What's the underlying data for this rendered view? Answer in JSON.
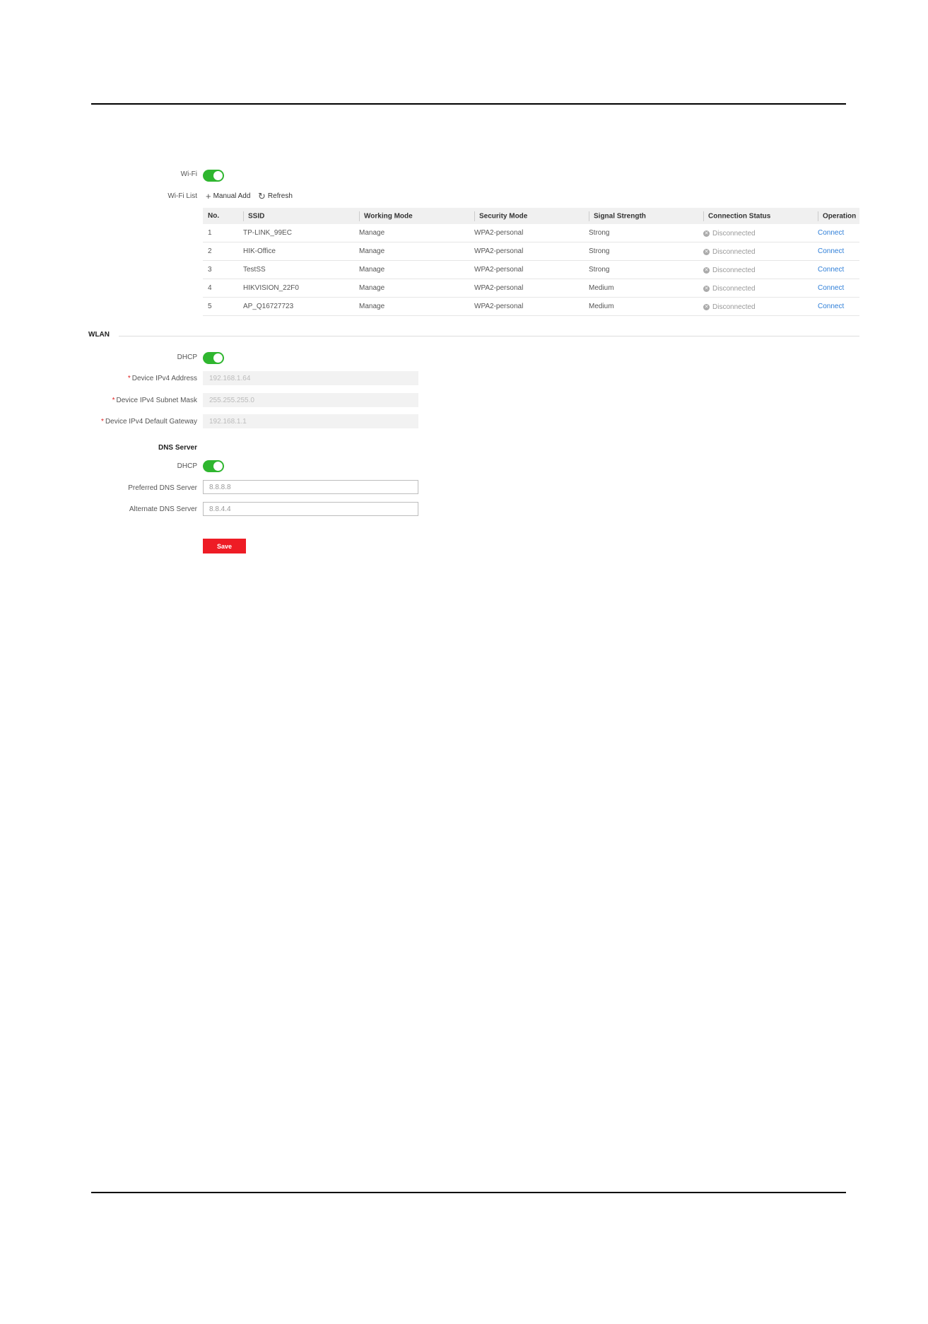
{
  "wifi": {
    "label": "Wi-Fi",
    "enabled": true
  },
  "wifi_list": {
    "label": "Wi-Fi List",
    "manual_add": "Manual Add",
    "refresh": "Refresh",
    "columns": [
      "No.",
      "SSID",
      "Working Mode",
      "Security Mode",
      "Signal Strength",
      "Connection Status",
      "Operation"
    ],
    "rows": [
      {
        "no": "1",
        "ssid": "TP-LINK_99EC",
        "mode": "Manage",
        "security": "WPA2-personal",
        "signal": "Strong",
        "status": "Disconnected",
        "op": "Connect"
      },
      {
        "no": "2",
        "ssid": "HIK-Office",
        "mode": "Manage",
        "security": "WPA2-personal",
        "signal": "Strong",
        "status": "Disconnected",
        "op": "Connect"
      },
      {
        "no": "3",
        "ssid": "TestSS",
        "mode": "Manage",
        "security": "WPA2-personal",
        "signal": "Strong",
        "status": "Disconnected",
        "op": "Connect"
      },
      {
        "no": "4",
        "ssid": "HIKVISION_22F0",
        "mode": "Manage",
        "security": "WPA2-personal",
        "signal": "Medium",
        "status": "Disconnected",
        "op": "Connect"
      },
      {
        "no": "5",
        "ssid": "AP_Q16727723",
        "mode": "Manage",
        "security": "WPA2-personal",
        "signal": "Medium",
        "status": "Disconnected",
        "op": "Connect"
      }
    ]
  },
  "wlan": {
    "title": "WLAN",
    "dhcp_label": "DHCP",
    "ipv4_address_label": "Device IPv4 Address",
    "ipv4_address_value": "192.168.1.64",
    "subnet_mask_label": "Device IPv4 Subnet Mask",
    "subnet_mask_value": "255.255.255.0",
    "gateway_label": "Device IPv4 Default Gateway",
    "gateway_value": "192.168.1.1"
  },
  "dns": {
    "title": "DNS Server",
    "dhcp_label": "DHCP",
    "preferred_label": "Preferred DNS Server",
    "preferred_value": "8.8.8.8",
    "alternate_label": "Alternate DNS Server",
    "alternate_value": "8.8.4.4"
  },
  "save_label": "Save",
  "colors": {
    "toggle_on": "#2fb62f",
    "save": "#ee1c25",
    "link": "#2f7fd8"
  }
}
